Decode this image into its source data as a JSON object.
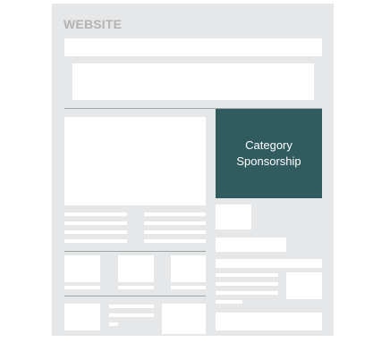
{
  "site": {
    "title": "WEBSITE"
  },
  "sponsor": {
    "line1": "Category",
    "line2": "Sponsorship"
  },
  "colors": {
    "frame": "#e6e7e8",
    "placeholder": "#ffffff",
    "sponsor_bg": "#305c5f",
    "sponsor_text": "#ffffff",
    "title": "#b3b3b3",
    "divider": "#9ea3a6"
  }
}
